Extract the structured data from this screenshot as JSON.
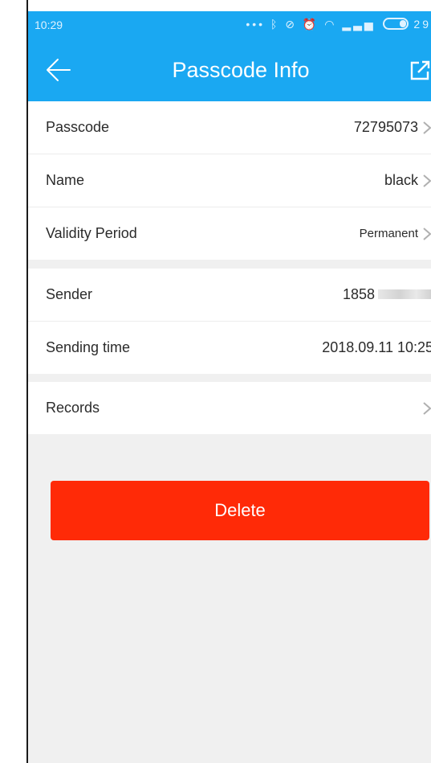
{
  "status_bar": {
    "time": "10:29",
    "icons": [
      "more-dots-icon",
      "bluetooth-icon",
      "mute-icon",
      "alarm-icon",
      "wifi-icon",
      "signal-icon",
      "battery-icon"
    ],
    "battery_text": "29"
  },
  "header": {
    "title": "Passcode Info",
    "background_color": "#1aa8f2"
  },
  "passcode_group": [
    {
      "label": "Passcode",
      "value": "72795073"
    },
    {
      "label": "Name",
      "value": "black"
    },
    {
      "label": "Validity Period",
      "value": "Permanent"
    }
  ],
  "sender_group": [
    {
      "label": "Sender",
      "value": "1858"
    },
    {
      "label": "Sending time",
      "value": "2018.09.11 10:25"
    }
  ],
  "records_group": [
    {
      "label": "Records",
      "value": ""
    }
  ],
  "delete_button": {
    "label": "Delete",
    "color": "#ff2a07"
  }
}
